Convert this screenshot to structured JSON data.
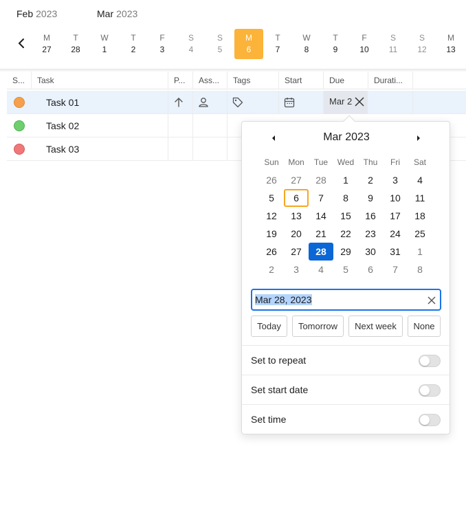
{
  "header": {
    "months": [
      {
        "month": "Feb",
        "year": "2023"
      },
      {
        "month": "Mar",
        "year": "2023"
      }
    ]
  },
  "timeline": {
    "days": [
      {
        "dow": "M",
        "dom": "27"
      },
      {
        "dow": "T",
        "dom": "28"
      },
      {
        "dow": "W",
        "dom": "1"
      },
      {
        "dow": "T",
        "dom": "2"
      },
      {
        "dow": "F",
        "dom": "3"
      },
      {
        "dow": "S",
        "dom": "4"
      },
      {
        "dow": "S",
        "dom": "5"
      },
      {
        "dow": "M",
        "dom": "6"
      },
      {
        "dow": "T",
        "dom": "7"
      },
      {
        "dow": "W",
        "dom": "8"
      },
      {
        "dow": "T",
        "dom": "9"
      },
      {
        "dow": "F",
        "dom": "10"
      },
      {
        "dow": "S",
        "dom": "11"
      },
      {
        "dow": "S",
        "dom": "12"
      },
      {
        "dow": "M",
        "dom": "13"
      }
    ]
  },
  "table": {
    "columns": [
      "S...",
      "Task",
      "P...",
      "Ass...",
      "Tags",
      "Start",
      "Due",
      "Durati..."
    ],
    "rows": [
      {
        "name": "Task 01",
        "due": "Mar 2",
        "status_color": "#f6a04d"
      },
      {
        "name": "Task 02",
        "status_color": "#6fcf6f"
      },
      {
        "name": "Task 03",
        "status_color": "#f07878"
      }
    ]
  },
  "picker": {
    "title": "Mar 2023",
    "weekdays": [
      "Sun",
      "Mon",
      "Tue",
      "Wed",
      "Thu",
      "Fri",
      "Sat"
    ],
    "weeks": [
      [
        "26",
        "27",
        "28",
        "1",
        "2",
        "3",
        "4"
      ],
      [
        "5",
        "6",
        "7",
        "8",
        "9",
        "10",
        "11"
      ],
      [
        "12",
        "13",
        "14",
        "15",
        "16",
        "17",
        "18"
      ],
      [
        "19",
        "20",
        "21",
        "22",
        "23",
        "24",
        "25"
      ],
      [
        "26",
        "27",
        "28",
        "29",
        "30",
        "31",
        "1"
      ],
      [
        "2",
        "3",
        "4",
        "5",
        "6",
        "7",
        "8"
      ]
    ],
    "input_value": "Mar 28, 2023",
    "quick": {
      "today": "Today",
      "tomorrow": "Tomorrow",
      "next_week": "Next week",
      "none": "None"
    },
    "options": {
      "repeat": "Set to repeat",
      "start_date": "Set start date",
      "time": "Set time"
    }
  },
  "colors": {
    "today_accent": "#fbb339",
    "selected_day": "#0b66d6",
    "input_border": "#1a73e8"
  }
}
